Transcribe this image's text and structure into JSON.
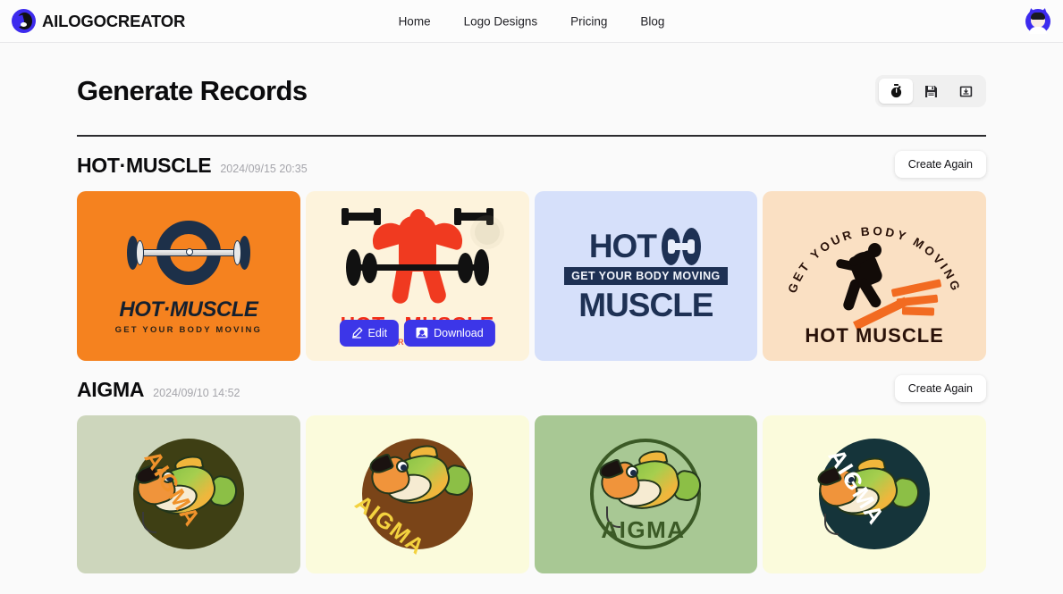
{
  "brand": {
    "name": "AILOGOCREATOR",
    "logo_icon": "ailogocreator-mark-icon"
  },
  "nav": {
    "items": [
      {
        "label": "Home"
      },
      {
        "label": "Logo Designs"
      },
      {
        "label": "Pricing"
      },
      {
        "label": "Blog"
      }
    ]
  },
  "account": {
    "avatar_icon": "user-avatar-icon"
  },
  "page": {
    "title": "Generate Records"
  },
  "toolbar": {
    "buttons": [
      {
        "icon": "stopwatch-icon",
        "name": "history-view-button",
        "active": true
      },
      {
        "icon": "floppy-disk-icon",
        "name": "saved-view-button",
        "active": false
      },
      {
        "icon": "image-download-icon",
        "name": "downloads-view-button",
        "active": false
      }
    ]
  },
  "card_actions": {
    "edit_label": "Edit",
    "edit_icon": "pencil-icon",
    "download_label": "Download",
    "download_icon": "image-icon"
  },
  "groups": [
    {
      "title": "HOT·MUSCLE",
      "timestamp": "2024/09/15 20:35",
      "create_again_label": "Create Again",
      "cards": [
        {
          "style": "hm1",
          "bg": "#F5821F",
          "name": "logo-card-hot-muscle-1",
          "title": "HOT·MUSCLE",
          "tagline": "GET YOUR BODY MOVING",
          "hovered": false
        },
        {
          "style": "hm2",
          "bg": "#FDF3DC",
          "name": "logo-card-hot-muscle-2",
          "title": "HOT · MUSCLE",
          "tagline": "GET YOUR BODY MOVING",
          "hovered": true
        },
        {
          "style": "hm3",
          "bg": "#D6E0FA",
          "name": "logo-card-hot-muscle-3",
          "title_part1": "HOT",
          "title_part2": "MUSCLE",
          "tagline": "GET YOUR BODY MOVING",
          "hovered": false
        },
        {
          "style": "hm4",
          "bg": "#FAE0C3",
          "name": "logo-card-hot-muscle-4",
          "title": "HOT     MUSCLE",
          "tagline": "GET YOUR BODY MOVING",
          "hovered": false
        }
      ]
    },
    {
      "title": "AIGMA",
      "timestamp": "2024/09/10 14:52",
      "create_again_label": "Create Again",
      "cards": [
        {
          "style": "fish1",
          "bg": "#CDD6BC",
          "disc": "#3E3F14",
          "text_color": "#F0922B",
          "name": "logo-card-aigma-1",
          "title": "AIGMA",
          "hovered": false
        },
        {
          "style": "fish2",
          "bg": "#FBFBDC",
          "disc": "#7A4418",
          "text_color": "#F3D23F",
          "name": "logo-card-aigma-2",
          "title": "AIGMA",
          "hovered": false
        },
        {
          "style": "fish3",
          "bg": "#A8C894",
          "disc": "transparent",
          "text_color": "#3B5A26",
          "name": "logo-card-aigma-3",
          "title": "AIGMA",
          "hovered": false
        },
        {
          "style": "fish4",
          "bg": "#FBFBDC",
          "disc": "#15343A",
          "text_color": "#FFFFFF",
          "name": "logo-card-aigma-4",
          "title": "AIGMA",
          "hovered": false
        }
      ]
    }
  ],
  "colors": {
    "brand_purple": "#3D2BEE",
    "action_blue": "#3C36E8",
    "page_bg": "#FAFAFA",
    "header_bg": "#FCFCFC",
    "divider": "#2B2B2E",
    "muted_text": "#A5A5AB"
  }
}
